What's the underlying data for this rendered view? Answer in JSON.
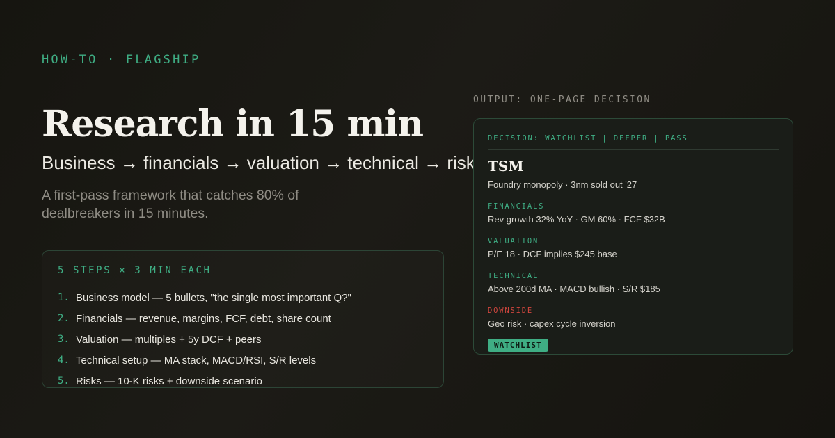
{
  "kicker": "HOW-TO · FLAGSHIP",
  "title": "Research in 15 min",
  "subtitle": "Business → financials → valuation → technical → risk",
  "lede": "A first-pass framework that catches 80% of dealbreakers in 15 minutes.",
  "steps": {
    "header": "5 STEPS × 3 MIN EACH",
    "items": [
      {
        "num": "1.",
        "text": "Business model — 5 bullets, \"the single most important Q?\""
      },
      {
        "num": "2.",
        "text": "Financials — revenue, margins, FCF, debt, share count"
      },
      {
        "num": "3.",
        "text": "Valuation — multiples + 5y DCF + peers"
      },
      {
        "num": "4.",
        "text": "Technical setup — MA stack, MACD/RSI, S/R levels"
      },
      {
        "num": "5.",
        "text": "Risks — 10-K risks + downside scenario"
      }
    ]
  },
  "output": {
    "label": "OUTPUT: ONE-PAGE DECISION",
    "decision_header": "DECISION: WATCHLIST | DEEPER | PASS",
    "ticker": "TSM",
    "tagline": "Foundry monopoly · 3nm sold out '27",
    "sections": {
      "financials": {
        "label": "FINANCIALS",
        "value": "Rev growth 32% YoY · GM 60% · FCF $32B"
      },
      "valuation": {
        "label": "VALUATION",
        "value": "P/E 18 · DCF implies $245 base"
      },
      "technical": {
        "label": "TECHNICAL",
        "value": "Above 200d MA · MACD bullish · S/R $185"
      },
      "downside": {
        "label": "DOWNSIDE",
        "value": "Geo risk · capex cycle inversion"
      }
    },
    "badge": "WATCHLIST"
  },
  "colors": {
    "accent": "#3fae84",
    "downside": "#d0463e",
    "background": "#1a1914"
  }
}
